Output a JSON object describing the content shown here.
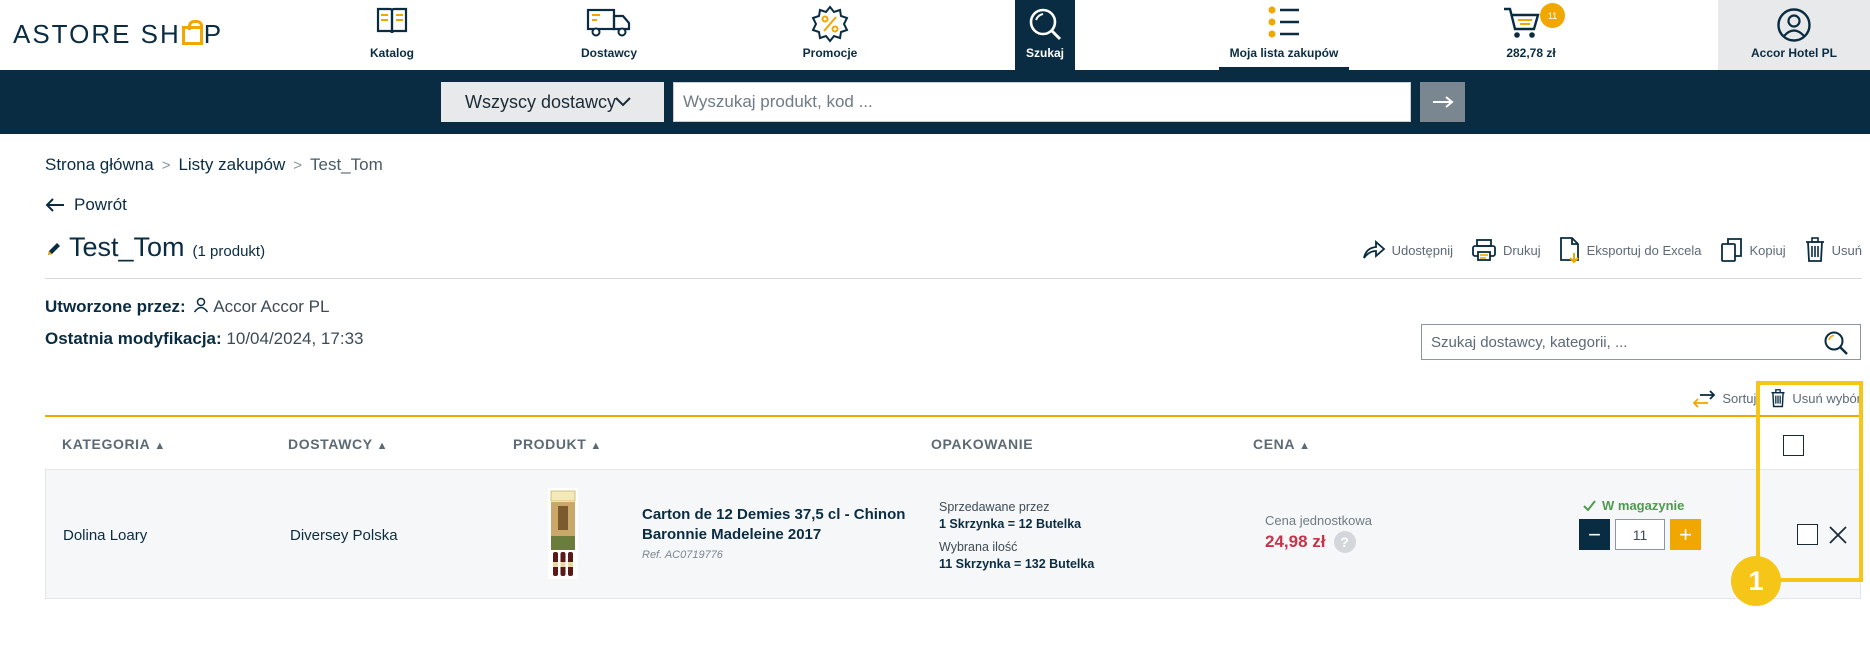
{
  "brand": {
    "logo_text_left": "ASTORE SH",
    "logo_text_right": "P"
  },
  "nav": {
    "katalog": "Katalog",
    "dostawcy": "Dostawcy",
    "promocje": "Promocje",
    "szukaj": "Szukaj",
    "lista": "Moja lista zakupów",
    "cart_total": "282,78 zł",
    "cart_count": "11",
    "account": "Accor Hotel PL"
  },
  "search": {
    "supplier_select": "Wszyscy dostawcy",
    "placeholder": "Wyszukaj produkt, kod ...",
    "go_symbol": "⟶"
  },
  "breadcrumb": {
    "home": "Strona główna",
    "lists": "Listy zakupów",
    "current": "Test_Tom",
    "sep": ">"
  },
  "back_label": "Powrót",
  "list": {
    "title": "Test_Tom",
    "count": "(1 produkt)",
    "created_by_label": "Utworzone przez:",
    "created_by": "Accor Accor PL",
    "modified_label": "Ostatnia modyfikacja:",
    "modified": "10/04/2024, 17:33"
  },
  "actions": {
    "share": "Udostępnij",
    "print": "Drukuj",
    "export": "Eksportuj do Excela",
    "copy": "Kopiuj",
    "delete": "Usuń"
  },
  "filter": {
    "placeholder": "Szukaj dostawcy, kategorii, ..."
  },
  "toolbar": {
    "sort": "Sortuj",
    "delete_selection": "Usuń wybór"
  },
  "table": {
    "headers": {
      "category": "KATEGORIA",
      "supplier": "DOSTAWCY",
      "product": "PRODUKT",
      "packaging": "OPAKOWANIE",
      "price": "CENA",
      "sort_arrow": "▲"
    },
    "row": {
      "category": "Dolina Loary",
      "supplier": "Diversey Polska",
      "product_name": "Carton de 12 Demies 37,5 cl - Chinon Baronnie Madeleine 2017",
      "ref": "Ref. AC0719776",
      "sold_by_label": "Sprzedawane przez",
      "sold_by_value": "1 Skrzynka = 12 Butelka",
      "selected_label": "Wybrana ilość",
      "selected_value": "11 Skrzynka = 132 Butelka",
      "unit_price_label": "Cena jednostkowa",
      "unit_price": "24,98 zł",
      "help": "?",
      "stock": "W magazynie",
      "quantity": "11",
      "minus": "−",
      "plus": "+"
    }
  },
  "annotation": {
    "badge": "1"
  },
  "colors": {
    "navy": "#0a2c42",
    "accent": "#f0a800",
    "price": "#c8334a",
    "stock": "#4f9a4f",
    "highlight": "#f5c518"
  }
}
